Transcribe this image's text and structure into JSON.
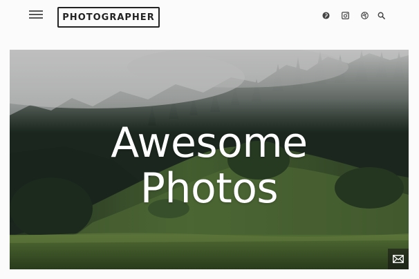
{
  "header": {
    "logo_text": "PHOTOGRAPHER",
    "icons": [
      "menu-icon",
      "pinterest-icon",
      "instagram-icon",
      "dribbble-icon",
      "search-icon"
    ]
  },
  "hero": {
    "title_line1": "Awesome",
    "title_line2": "Photos",
    "contact_icon": "mail-icon"
  },
  "colors": {
    "background": "#fbfbfb",
    "logo_border": "#222222",
    "title_text": "#ffffff",
    "icon_color": "#444444"
  }
}
